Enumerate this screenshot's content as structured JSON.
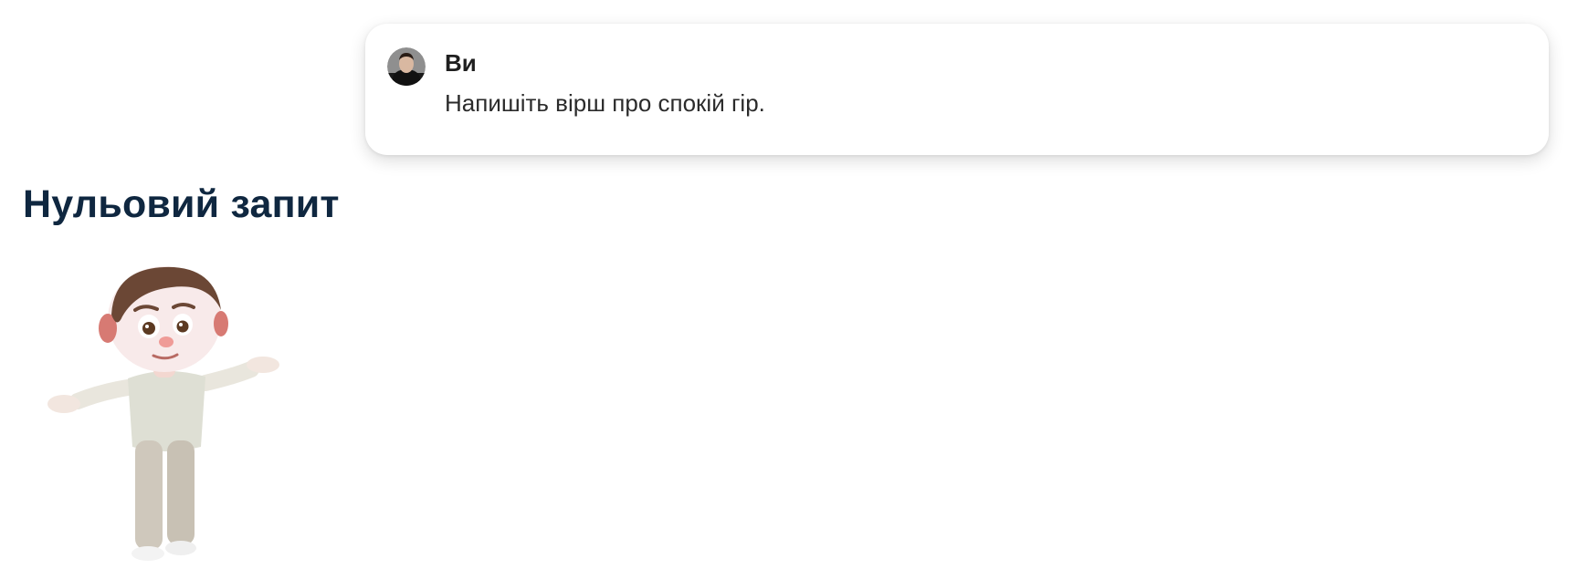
{
  "message": {
    "sender": "Ви",
    "text": "Напишіть вірш про спокій гір."
  },
  "section": {
    "title": "Нульовий запит"
  },
  "icons": {
    "avatar": "user-avatar-photo",
    "character": "shrugging-cartoon-boy"
  }
}
